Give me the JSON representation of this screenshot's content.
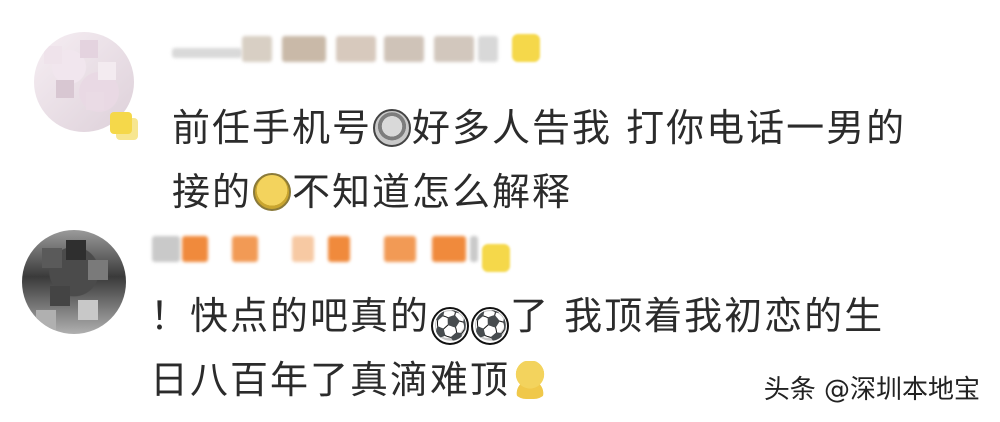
{
  "comments": [
    {
      "avatar_icon": "blurred-avatar",
      "username_state": "mosaic-blurred",
      "text_parts": [
        "前任手机号",
        "好多人告我 打你电话一男的",
        "接的",
        "不知道怎么解释"
      ],
      "emojis": [
        "scared-face-icon",
        "crying-face-icon"
      ]
    },
    {
      "avatar_icon": "blurred-avatar",
      "username_state": "mosaic-blurred",
      "text_parts": [
        "！快点的吧真的",
        "了 我顶着我初恋的生",
        "日八百年了真滴难顶"
      ],
      "emojis": [
        "soccer-ball-icon",
        "soccer-ball-icon",
        "sitting-figure-icon"
      ],
      "soccer_glyph": "⚽"
    }
  ],
  "watermark": {
    "text": "头条 @深圳本地宝"
  },
  "colors": {
    "text": "#2b2b2b",
    "background": "#ffffff",
    "blur_orange": "#f08a3c",
    "blur_yellow": "#f5d84a"
  }
}
